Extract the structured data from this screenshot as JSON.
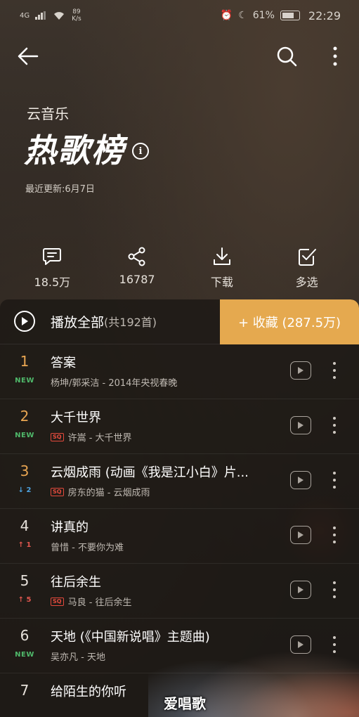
{
  "status_bar": {
    "network": "4G",
    "speed_value": "89",
    "speed_unit": "K/s",
    "battery": "61%",
    "time": "22:29"
  },
  "header": {
    "brand": "云音乐",
    "title": "热歌榜",
    "update_text": "最近更新:6月7日"
  },
  "actions": [
    {
      "label": "18.5万",
      "icon": "comment-icon"
    },
    {
      "label": "16787",
      "icon": "share-icon"
    },
    {
      "label": "下载",
      "icon": "download-icon"
    },
    {
      "label": "多选",
      "icon": "multiselect-icon"
    }
  ],
  "play_all": {
    "label": "播放全部",
    "count": "(共192首)",
    "collect_label": "+ 收藏 (287.5万)"
  },
  "songs": [
    {
      "rank": "1",
      "trend": "NEW",
      "title": "答案",
      "meta": "杨坤/郭采洁 - 2014年央视春晚",
      "sq": false
    },
    {
      "rank": "2",
      "trend": "NEW",
      "title": "大千世界",
      "meta": "许嵩 - 大千世界",
      "sq": true
    },
    {
      "rank": "3",
      "trend": "↓ 2",
      "title": "云烟成雨 (动画《我是江小白》片...",
      "meta": "房东的猫 - 云烟成雨",
      "sq": true
    },
    {
      "rank": "4",
      "trend": "↑ 1",
      "title": "讲真的",
      "meta": "曾惜 - 不要你为难",
      "sq": false
    },
    {
      "rank": "5",
      "trend": "↑ 5",
      "title": "往后余生",
      "meta": "马良 - 往后余生",
      "sq": true
    },
    {
      "rank": "6",
      "trend": "NEW",
      "title": "天地 (《中国新说唱》主题曲)",
      "meta": "吴亦凡 - 天地",
      "sq": false
    },
    {
      "rank": "7",
      "trend": "",
      "title": "给陌生的你听",
      "meta": "",
      "sq": false
    }
  ],
  "sq_label": "SQ",
  "watermark": "爱唱歌",
  "colors": {
    "accent": "#e5a94f",
    "rank_top": "#e9a652",
    "new": "#4fb86a",
    "up": "#e0574f",
    "down": "#4da3e0"
  }
}
